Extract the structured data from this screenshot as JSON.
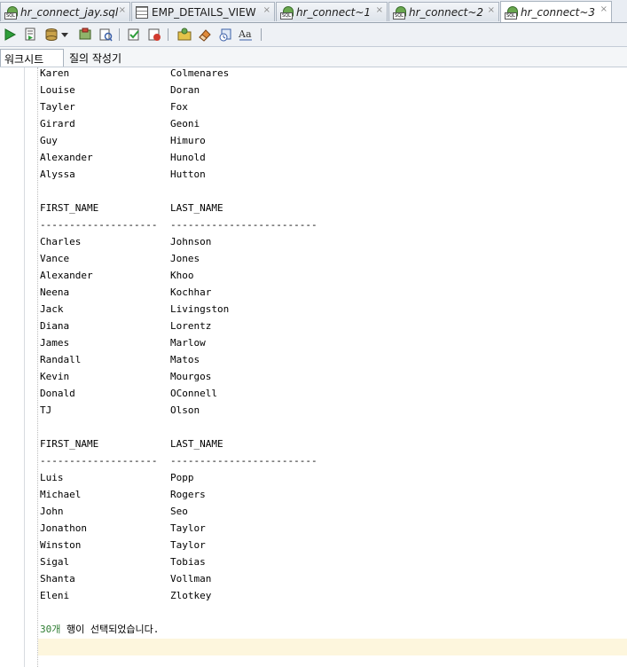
{
  "tabs": [
    {
      "label": "hr_connect_jay.sql",
      "icon": "sql-file-icon",
      "active": false
    },
    {
      "label": "EMP_DETAILS_VIEW",
      "icon": "view-icon",
      "active": false
    },
    {
      "label": "hr_connect~1",
      "icon": "sql-file-icon",
      "active": false
    },
    {
      "label": "hr_connect~2",
      "icon": "sql-file-icon",
      "active": false
    },
    {
      "label": "hr_connect~3",
      "icon": "sql-file-icon",
      "active": true
    }
  ],
  "tab_close_glyph": "×",
  "toolbar": {
    "buttons": [
      "run-statement-icon",
      "run-script-icon",
      "commit-icon",
      "dropdown-arrow-icon",
      "rollback-icon",
      "explain-plan-icon",
      "autotrace-icon",
      "sql-history-icon",
      "tuning-advisor-icon",
      "eraser-icon",
      "unshared-worksheet-icon",
      "to-upper-lower-icon"
    ]
  },
  "subtabs": {
    "worksheet": "워크시트",
    "query_builder": "질의 작성기"
  },
  "output": {
    "block1": [
      [
        "Karen",
        "Colmenares"
      ],
      [
        "Louise",
        "Doran"
      ],
      [
        "Tayler",
        "Fox"
      ],
      [
        "Girard",
        "Geoni"
      ],
      [
        "Guy",
        "Himuro"
      ],
      [
        "Alexander",
        "Hunold"
      ],
      [
        "Alyssa",
        "Hutton"
      ]
    ],
    "header": [
      "FIRST_NAME",
      "LAST_NAME"
    ],
    "underline": [
      "--------------------",
      "-------------------------"
    ],
    "block2": [
      [
        "Charles",
        "Johnson"
      ],
      [
        "Vance",
        "Jones"
      ],
      [
        "Alexander",
        "Khoo"
      ],
      [
        "Neena",
        "Kochhar"
      ],
      [
        "Jack",
        "Livingston"
      ],
      [
        "Diana",
        "Lorentz"
      ],
      [
        "James",
        "Marlow"
      ],
      [
        "Randall",
        "Matos"
      ],
      [
        "Kevin",
        "Mourgos"
      ],
      [
        "Donald",
        "OConnell"
      ],
      [
        "TJ",
        "Olson"
      ]
    ],
    "block3": [
      [
        "Luis",
        "Popp"
      ],
      [
        "Michael",
        "Rogers"
      ],
      [
        "John",
        "Seo"
      ],
      [
        "Jonathon",
        "Taylor"
      ],
      [
        "Winston",
        "Taylor"
      ],
      [
        "Sigal",
        "Tobias"
      ],
      [
        "Shanta",
        "Vollman"
      ],
      [
        "Eleni",
        "Zlotkey"
      ]
    ],
    "status_count": "30개",
    "status_text": " 행이 선택되었습니다."
  }
}
